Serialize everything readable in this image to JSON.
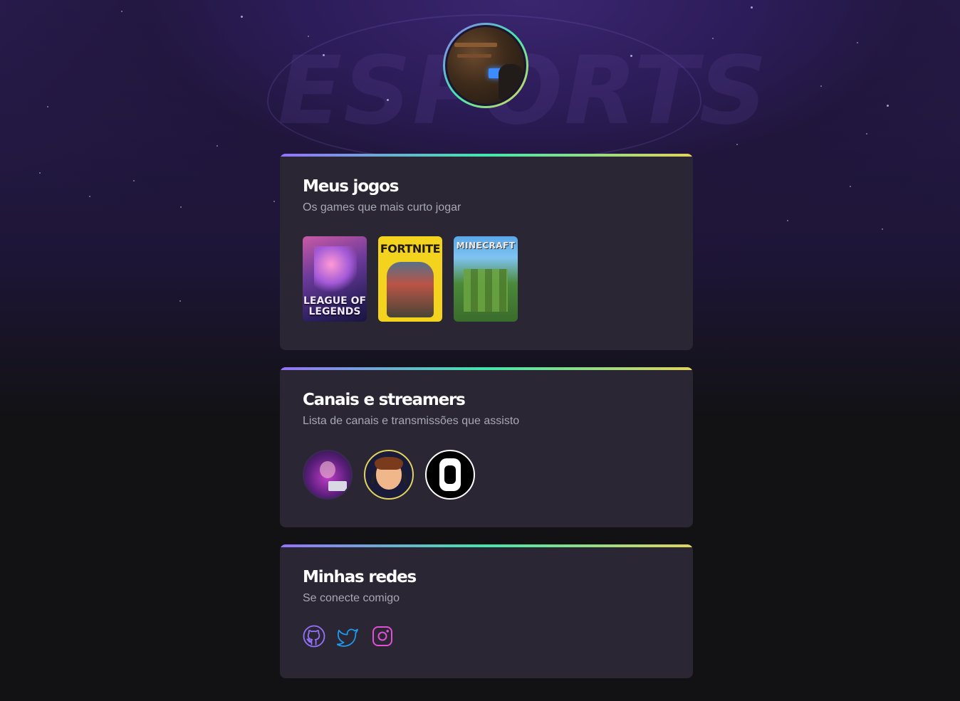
{
  "background": {
    "watermark": "ESPORTS"
  },
  "profile": {
    "avatar_alt": "Foto de perfil"
  },
  "games_card": {
    "title": "Meus jogos",
    "subtitle": "Os games que mais curto jogar",
    "games": [
      {
        "name": "League of Legends",
        "cover_title": "LEAGUE OF LEGENDS"
      },
      {
        "name": "Fortnite",
        "cover_title": "FORTNITE"
      },
      {
        "name": "Minecraft",
        "cover_title": "MINECRAFT"
      }
    ]
  },
  "streamers_card": {
    "title": "Canais e streamers",
    "subtitle": "Lista de canais e transmissões que assisto",
    "streamers": [
      {
        "icon": "streamer-avatar-1"
      },
      {
        "icon": "streamer-avatar-2"
      },
      {
        "icon": "streamer-avatar-3"
      }
    ]
  },
  "social_card": {
    "title": "Minhas redes",
    "subtitle": "Se conecte comigo",
    "links": [
      {
        "icon": "github-icon",
        "color": "#9572FC"
      },
      {
        "icon": "twitter-icon",
        "color": "#1D9BF0"
      },
      {
        "icon": "instagram-icon",
        "color": "#E04FD6"
      }
    ]
  },
  "colors": {
    "gradient_start": "#9572FC",
    "gradient_mid": "#43E7AD",
    "gradient_end": "#E2D45C",
    "card_bg": "#2A2634",
    "page_bg": "#121214"
  }
}
